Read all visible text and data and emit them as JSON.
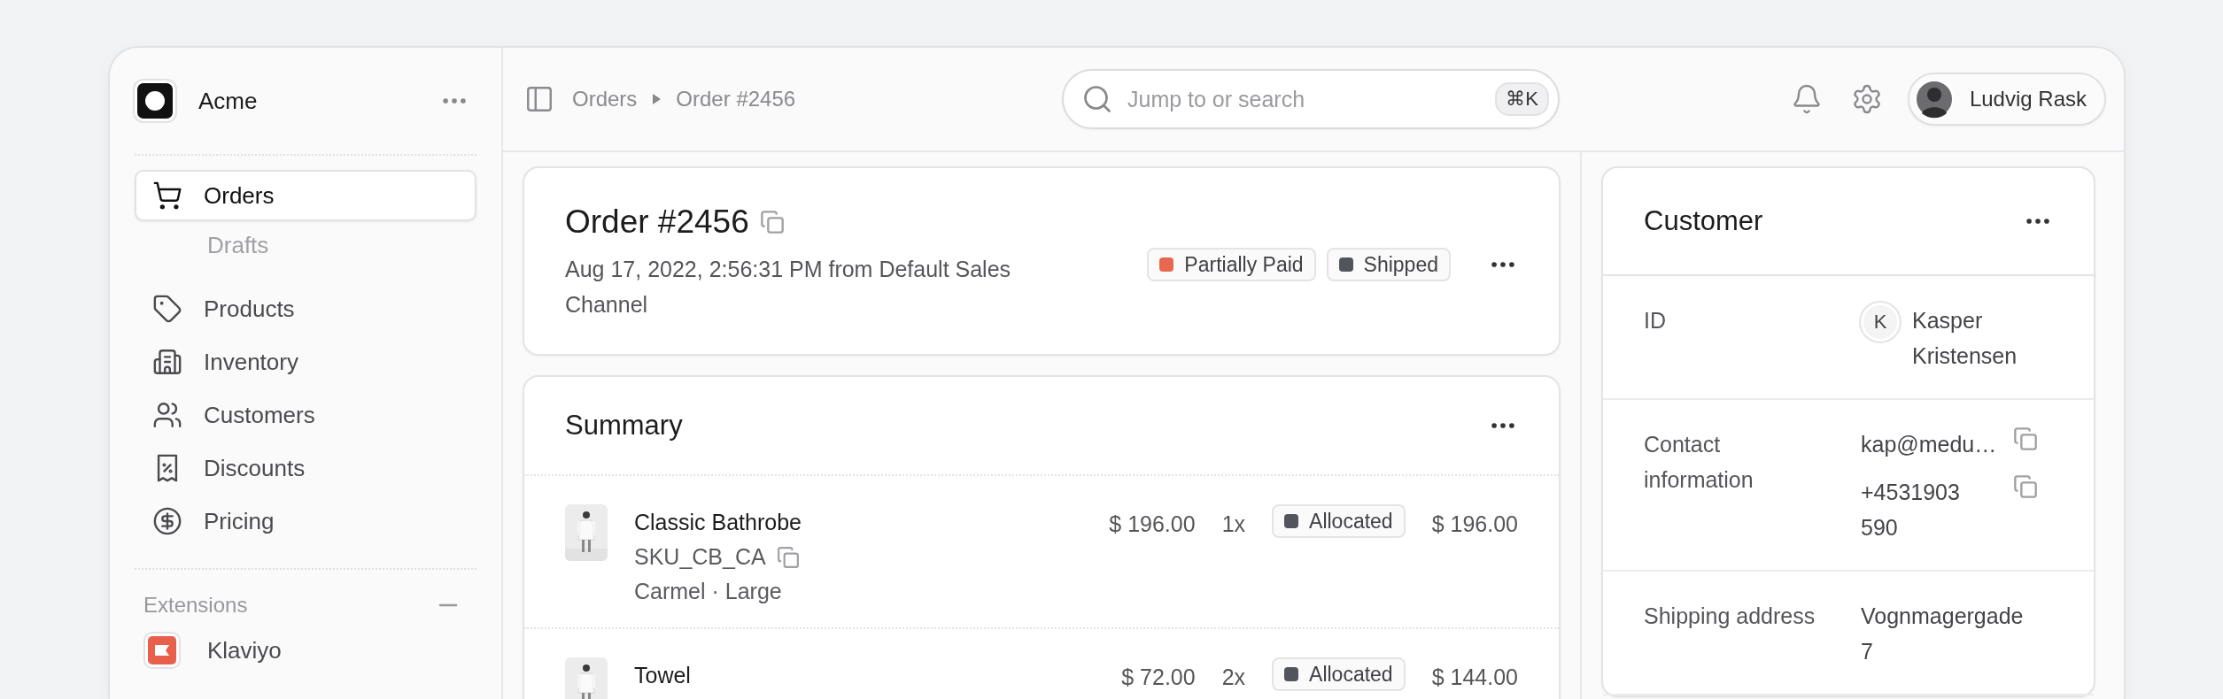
{
  "workspace": {
    "name": "Acme"
  },
  "sidebar": {
    "items": [
      {
        "label": "Orders",
        "selected": true,
        "children": [
          {
            "label": "Drafts",
            "selected": false
          }
        ]
      },
      {
        "label": "Products",
        "selected": false
      },
      {
        "label": "Inventory",
        "selected": false
      },
      {
        "label": "Customers",
        "selected": false
      },
      {
        "label": "Discounts",
        "selected": false
      },
      {
        "label": "Pricing",
        "selected": false
      }
    ],
    "extensions": {
      "title": "Extensions",
      "expanded": true,
      "items": [
        {
          "label": "Klaviyo",
          "color": "#e8604c"
        }
      ]
    }
  },
  "topbar": {
    "breadcrumb": [
      "Orders",
      "Order #2456"
    ],
    "search": {
      "placeholder": "Jump to or search",
      "shortcut": "⌘K"
    },
    "user": {
      "name": "Ludvig Rask"
    }
  },
  "order": {
    "title": "Order #2456",
    "subtitle": "Aug 17, 2022, 2:56:31 PM from Default Sales Channel",
    "badges": [
      {
        "label": "Partially Paid",
        "color": "#e8674f"
      },
      {
        "label": "Shipped",
        "color": "#52555c"
      }
    ]
  },
  "summary": {
    "title": "Summary",
    "items": [
      {
        "name": "Classic Bathrobe",
        "sku": "SKU_CB_CA",
        "variant": "Carmel · Large",
        "price": "$ 196.00",
        "qty": "1x",
        "status": {
          "label": "Allocated",
          "color": "#52555c"
        },
        "total": "$ 196.00"
      },
      {
        "name": "Towel",
        "price": "$ 72.00",
        "qty": "2x",
        "status": {
          "label": "Allocated",
          "color": "#52555c"
        },
        "total": "$ 144.00"
      }
    ]
  },
  "customer": {
    "title": "Customer",
    "rows": [
      {
        "label": "ID",
        "kind": "person",
        "initial": "K",
        "value": "Kasper Kristensen"
      },
      {
        "label": "Contact information",
        "kind": "contacts",
        "values": [
          "kap@medu…",
          "+4531903590"
        ]
      },
      {
        "label": "Shipping address",
        "kind": "text",
        "value": "Vognmagergade 7"
      }
    ]
  }
}
